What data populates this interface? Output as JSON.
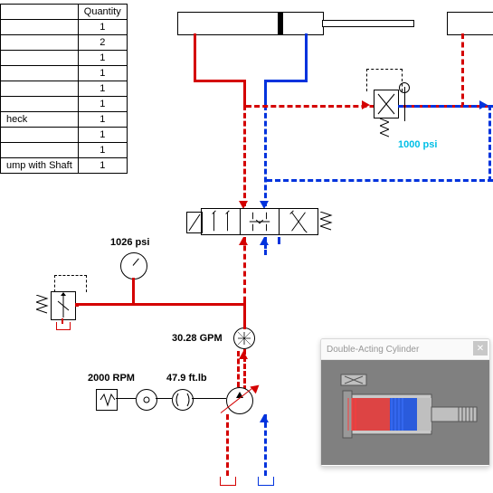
{
  "bom": {
    "header_qty": "Quantity",
    "rows": [
      {
        "name": "",
        "qty": "1"
      },
      {
        "name": "",
        "qty": "2"
      },
      {
        "name": "",
        "qty": "1"
      },
      {
        "name": "",
        "qty": "1"
      },
      {
        "name": "",
        "qty": "1"
      },
      {
        "name": "",
        "qty": "1"
      },
      {
        "name": "heck",
        "qty": "1"
      },
      {
        "name": "",
        "qty": "1"
      },
      {
        "name": "",
        "qty": "1"
      },
      {
        "name": "ump with Shaft",
        "qty": "1"
      }
    ]
  },
  "labels": {
    "gauge_pressure": "1026 psi",
    "sequence_pressure": "1000 psi",
    "flow": "30.28 GPM",
    "rpm": "2000 RPM",
    "torque": "47.9 ft.lb"
  },
  "popup": {
    "title": "Double-Acting Cylinder"
  },
  "components": {
    "relief_valve": "relief-valve",
    "gauge": "pressure-gauge",
    "dcv": "directional-control-valve",
    "sequence_valve": "sequence-valve",
    "flow_meter": "flow-meter",
    "motor": "electric-motor",
    "pump": "variable-displacement-pump",
    "cylinder1": "double-acting-cylinder-1",
    "cylinder2": "double-acting-cylinder-2"
  }
}
